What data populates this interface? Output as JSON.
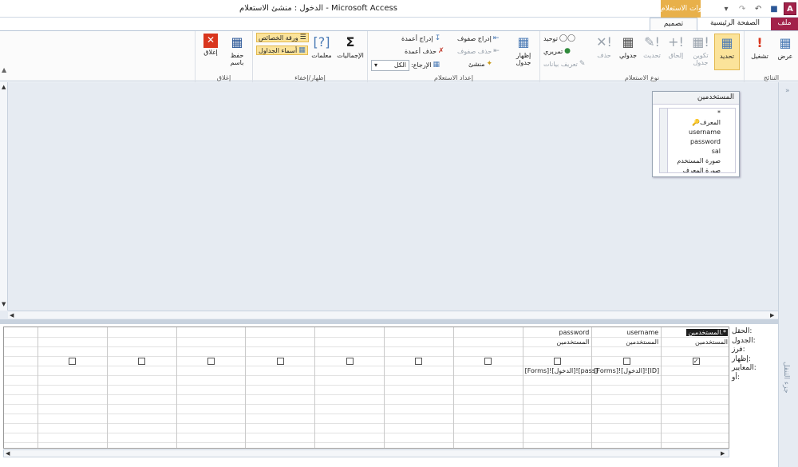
{
  "window": {
    "title": "الدخول : منشئ الاستعلام - Microsoft Access",
    "app_icon": "A",
    "context_tab_header": "أدوات الاستعلام"
  },
  "tabs": [
    {
      "label": "ملف",
      "active": false
    },
    {
      "label": "الصفحة الرئيسية",
      "active": false
    },
    {
      "label": "تصميم",
      "active": true
    }
  ],
  "ribbon": {
    "results": {
      "label": "النتائج",
      "view": "عرض",
      "run": "تشغيل"
    },
    "query_type": {
      "label": "نوع الاستعلام",
      "select": "تحديد",
      "make_table": "تكوين جدول",
      "append": "إلحاق",
      "update": "تحديث",
      "crosstab": "جدولي",
      "delete": "حذف",
      "union": "توحيد",
      "pass_through": "تمريري",
      "data_definition": "تعريف بيانات"
    },
    "setup": {
      "label": "إعداد الاستعلام",
      "show_table": "إظهار جدول",
      "insert_rows": "إدراج صفوف",
      "delete_rows": "حذف صفوف",
      "builder": "منشئ",
      "insert_columns": "إدراج أعمدة",
      "delete_columns": "حذف أعمدة",
      "return_label": "الإرجاع:",
      "return_value": "الكل"
    },
    "show_hide": {
      "label": "إظهار/إخفاء",
      "totals": "الإجماليات",
      "parameters": "معلمات",
      "property_sheet": "ورقة الخصائص",
      "table_names": "أسماء الجداول"
    },
    "close": {
      "label": "إغلاق",
      "save_as": "حفظ باسم",
      "close": "إغلاق"
    }
  },
  "table_box": {
    "title": "المستخدمين",
    "fields": [
      "*",
      "المعرف",
      "username",
      "password",
      "sal",
      "صورة المستخدم",
      "صورة المعرف"
    ]
  },
  "row_labels": [
    "الحقل:",
    "الجدول:",
    "فرز:",
    "إظهار:",
    "المعايير:",
    "أو:"
  ],
  "qbe_columns": [
    {
      "field": "المستخدمين.*",
      "table": "المستخدمين",
      "show": true,
      "criteria": ""
    },
    {
      "field": "username",
      "table": "المستخدمين",
      "show": false,
      "criteria": "[Forms]![الدخول]![ID]"
    },
    {
      "field": "password",
      "table": "المستخدمين",
      "show": false,
      "criteria": "[Forms]![الدخول]![pass]"
    },
    {
      "field": "",
      "table": "",
      "show": false,
      "criteria": ""
    },
    {
      "field": "",
      "table": "",
      "show": false,
      "criteria": ""
    },
    {
      "field": "",
      "table": "",
      "show": false,
      "criteria": ""
    },
    {
      "field": "",
      "table": "",
      "show": false,
      "criteria": ""
    },
    {
      "field": "",
      "table": "",
      "show": false,
      "criteria": ""
    },
    {
      "field": "",
      "table": "",
      "show": false,
      "criteria": ""
    },
    {
      "field": "",
      "table": "",
      "show": false,
      "criteria": ""
    }
  ],
  "side_panel": {
    "label": "جزء التنقل"
  },
  "colors": {
    "file_tab": "#a2224a",
    "context_tab": "#e8b04a",
    "query_bg": "#e6ebf2"
  }
}
